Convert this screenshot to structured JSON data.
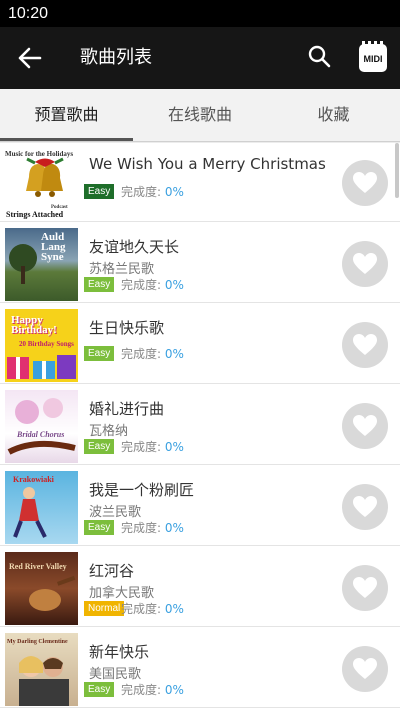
{
  "status_bar": {
    "time": "10:20"
  },
  "app_bar": {
    "title": "歌曲列表",
    "midi_label": "MIDI"
  },
  "tabs": [
    {
      "label": "预置歌曲",
      "active": true
    },
    {
      "label": "在线歌曲",
      "active": false
    },
    {
      "label": "收藏",
      "active": false
    }
  ],
  "progress_label": "完成度:",
  "songs": [
    {
      "title": "We Wish You a Merry Christmas",
      "artist": "",
      "difficulty": "Easy",
      "difficulty_color": "#1e6e2a",
      "progress": "0%",
      "cover": {
        "top": "Music for the Holidays",
        "bottom": "Strings Attached",
        "sub": "Podcast"
      }
    },
    {
      "title": "友谊地久天长",
      "artist": "苏格兰民歌",
      "difficulty": "Easy",
      "difficulty_color": "#7cbe3c",
      "progress": "0%",
      "cover": {
        "top": "Auld Lang Syne"
      }
    },
    {
      "title": "生日快乐歌",
      "artist": "",
      "difficulty": "Easy",
      "difficulty_color": "#7cbe3c",
      "progress": "0%",
      "cover": {
        "top": "Happy Birthday!",
        "sub": "20 Birthday Songs"
      }
    },
    {
      "title": "婚礼进行曲",
      "artist": "瓦格纳",
      "difficulty": "Easy",
      "difficulty_color": "#7cbe3c",
      "progress": "0%",
      "cover": {
        "top": "Bridal Chorus"
      }
    },
    {
      "title": "我是一个粉刷匠",
      "artist": "波兰民歌",
      "difficulty": "Easy",
      "difficulty_color": "#7cbe3c",
      "progress": "0%",
      "cover": {
        "top": "Krakowiaki"
      }
    },
    {
      "title": "红河谷",
      "artist": "加拿大民歌",
      "difficulty": "Normal",
      "difficulty_color": "#f0b400",
      "progress": "0%",
      "cover": {
        "top": "Red River Valley"
      }
    },
    {
      "title": "新年快乐",
      "artist": "美国民歌",
      "difficulty": "Easy",
      "difficulty_color": "#7cbe3c",
      "progress": "0%",
      "cover": {
        "top": "My Darling Clementine"
      }
    }
  ]
}
